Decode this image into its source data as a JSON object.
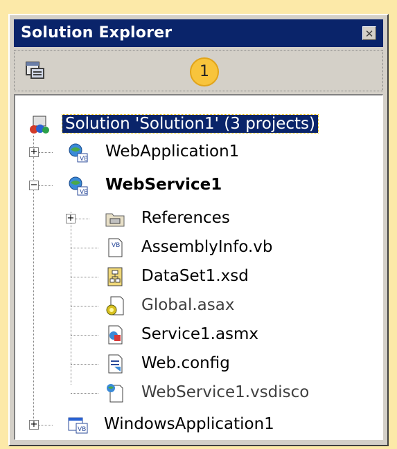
{
  "window": {
    "title": "Solution Explorer"
  },
  "callout": {
    "number": "1"
  },
  "tree": {
    "solution": "Solution 'Solution1' (3 projects)",
    "projects": [
      {
        "label": "WebApplication1",
        "expanded": false
      },
      {
        "label": "WebService1",
        "expanded": true,
        "bold": true,
        "children": [
          {
            "label": "References",
            "icon": "references-folder-icon"
          },
          {
            "label": "AssemblyInfo.vb",
            "icon": "vb-file-icon"
          },
          {
            "label": "DataSet1.xsd",
            "icon": "xsd-file-icon"
          },
          {
            "label": "Global.asax",
            "icon": "asax-file-icon"
          },
          {
            "label": "Service1.asmx",
            "icon": "asmx-file-icon"
          },
          {
            "label": "Web.config",
            "icon": "config-file-icon"
          },
          {
            "label": "WebService1.vsdisco",
            "icon": "vsdisco-file-icon"
          }
        ]
      },
      {
        "label": "WindowsApplication1",
        "expanded": false
      }
    ]
  },
  "expanders": {
    "plus": "+",
    "minus": "−"
  },
  "colors": {
    "titlebar": "#0a246a",
    "callout": "#f8c43c",
    "background": "#fce9a8"
  }
}
